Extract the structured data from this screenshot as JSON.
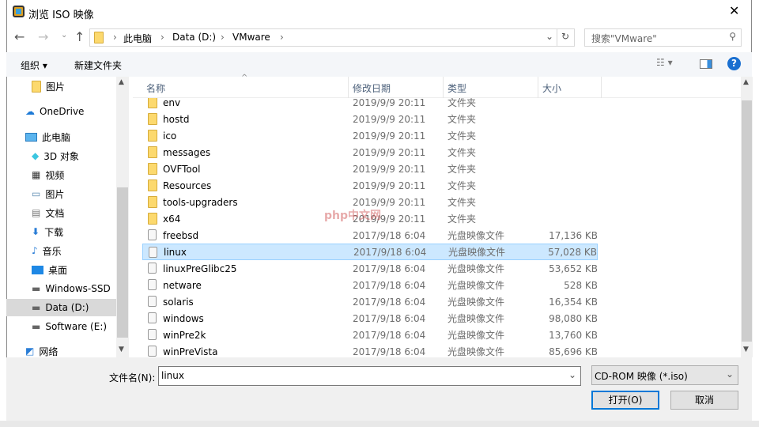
{
  "window": {
    "title": "浏览 ISO 映像",
    "close": "✕"
  },
  "address": {
    "crumbs": [
      "此电脑",
      "Data (D:)",
      "VMware"
    ],
    "search_placeholder": "搜索\"VMware\""
  },
  "toolbar": {
    "organize": "组织 ▾",
    "new_folder": "新建文件夹"
  },
  "nav": [
    {
      "label": "图片",
      "icon": "folder-icon"
    },
    {
      "label": "OneDrive",
      "icon": "cloud-icon"
    },
    {
      "label": "此电脑",
      "icon": "computer-icon"
    },
    {
      "label": "3D 对象",
      "icon": "cube-icon"
    },
    {
      "label": "视频",
      "icon": "video-icon"
    },
    {
      "label": "图片",
      "icon": "picture-icon"
    },
    {
      "label": "文档",
      "icon": "document-icon"
    },
    {
      "label": "下载",
      "icon": "download-icon"
    },
    {
      "label": "音乐",
      "icon": "music-icon"
    },
    {
      "label": "桌面",
      "icon": "desktop-icon"
    },
    {
      "label": "Windows-SSD",
      "icon": "drive-icon"
    },
    {
      "label": "Data (D:)",
      "icon": "drive-icon",
      "selected": true
    },
    {
      "label": "Software (E:)",
      "icon": "drive-icon"
    },
    {
      "label": "网络",
      "icon": "network-icon"
    }
  ],
  "columns": {
    "name": "名称",
    "date": "修改日期",
    "type": "类型",
    "size": "大小"
  },
  "files": [
    {
      "name": "env",
      "date": "2019/9/9 20:11",
      "type": "文件夹",
      "size": "",
      "folder": true
    },
    {
      "name": "hostd",
      "date": "2019/9/9 20:11",
      "type": "文件夹",
      "size": "",
      "folder": true
    },
    {
      "name": "ico",
      "date": "2019/9/9 20:11",
      "type": "文件夹",
      "size": "",
      "folder": true
    },
    {
      "name": "messages",
      "date": "2019/9/9 20:11",
      "type": "文件夹",
      "size": "",
      "folder": true
    },
    {
      "name": "OVFTool",
      "date": "2019/9/9 20:11",
      "type": "文件夹",
      "size": "",
      "folder": true
    },
    {
      "name": "Resources",
      "date": "2019/9/9 20:11",
      "type": "文件夹",
      "size": "",
      "folder": true
    },
    {
      "name": "tools-upgraders",
      "date": "2019/9/9 20:11",
      "type": "文件夹",
      "size": "",
      "folder": true
    },
    {
      "name": "x64",
      "date": "2019/9/9 20:11",
      "type": "文件夹",
      "size": "",
      "folder": true
    },
    {
      "name": "freebsd",
      "date": "2017/9/18 6:04",
      "type": "光盘映像文件",
      "size": "17,136 KB"
    },
    {
      "name": "linux",
      "date": "2017/9/18 6:04",
      "type": "光盘映像文件",
      "size": "57,028 KB",
      "selected": true
    },
    {
      "name": "linuxPreGlibc25",
      "date": "2017/9/18 6:04",
      "type": "光盘映像文件",
      "size": "53,652 KB"
    },
    {
      "name": "netware",
      "date": "2017/9/18 6:04",
      "type": "光盘映像文件",
      "size": "528 KB"
    },
    {
      "name": "solaris",
      "date": "2017/9/18 6:04",
      "type": "光盘映像文件",
      "size": "16,354 KB"
    },
    {
      "name": "windows",
      "date": "2017/9/18 6:04",
      "type": "光盘映像文件",
      "size": "98,080 KB"
    },
    {
      "name": "winPre2k",
      "date": "2017/9/18 6:04",
      "type": "光盘映像文件",
      "size": "13,760 KB"
    },
    {
      "name": "winPreVista",
      "date": "2017/9/18 6:04",
      "type": "光盘映像文件",
      "size": "85,696 KB"
    }
  ],
  "bottom": {
    "filename_label": "文件名(N):",
    "filename_value": "linux",
    "filter": "CD-ROM 映像 (*.iso)",
    "open": "打开(O)",
    "cancel": "取消"
  },
  "watermark": "php中文网"
}
